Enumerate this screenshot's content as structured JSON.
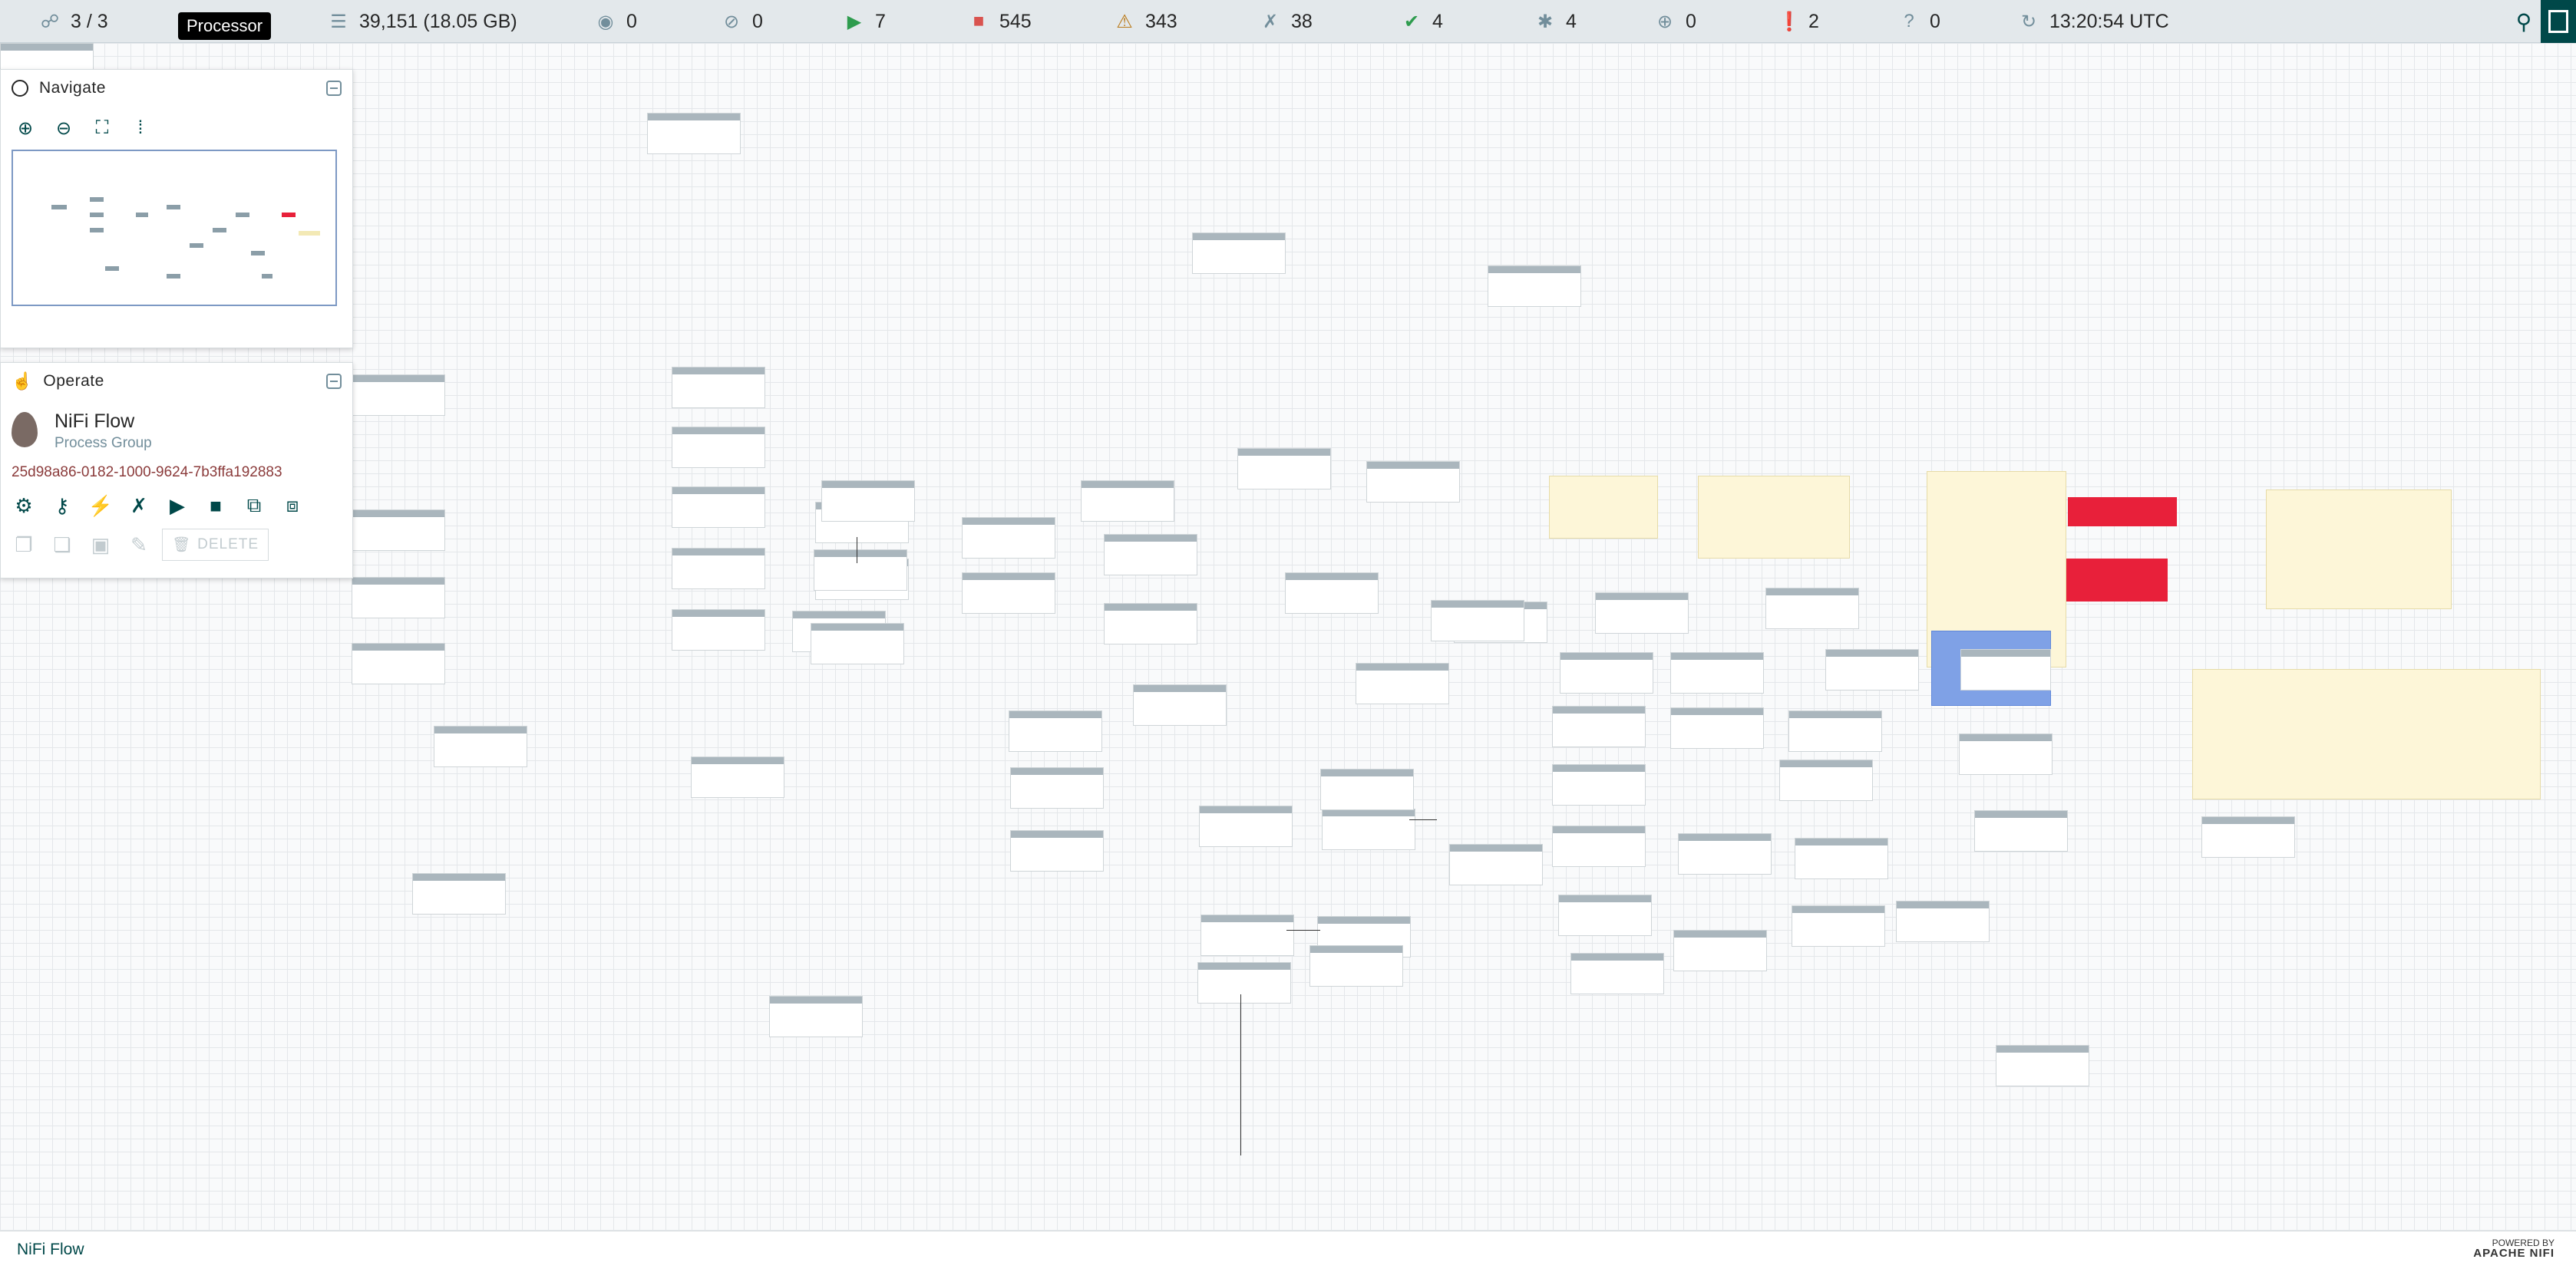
{
  "status_bar": {
    "cluster": "3 / 3",
    "queued": "39,151 (18.05 GB)",
    "transmitting": "0",
    "not_transmitting": "0",
    "running": "7",
    "stopped": "545",
    "invalid": "343",
    "disabled": "38",
    "up_to_date": "4",
    "locally_modified": "4",
    "stale": "0",
    "sync_failure": "2",
    "unknown": "0",
    "time": "13:20:54 UTC",
    "tooltip": "Processor"
  },
  "navigate_panel": {
    "title": "Navigate"
  },
  "operate_panel": {
    "title": "Operate",
    "name": "NiFi Flow",
    "type": "Process Group",
    "id": "25d98a86-0182-1000-9624-7b3ffa192883",
    "delete_label": "DELETE"
  },
  "breadcrumb": {
    "current": "NiFi Flow"
  },
  "footer": {
    "powered_by": "POWERED BY",
    "brand": "APACHE NIFI"
  },
  "colors": {
    "status_bar_bg": "#e3e8eb",
    "accent": "#004849",
    "running": "#2e9c4e",
    "stopped": "#d9534f",
    "invalid": "#ba7a19",
    "red_label": "#e8203a",
    "blue_label": "#7fa1e6",
    "group_label": "#fdf6d8"
  }
}
